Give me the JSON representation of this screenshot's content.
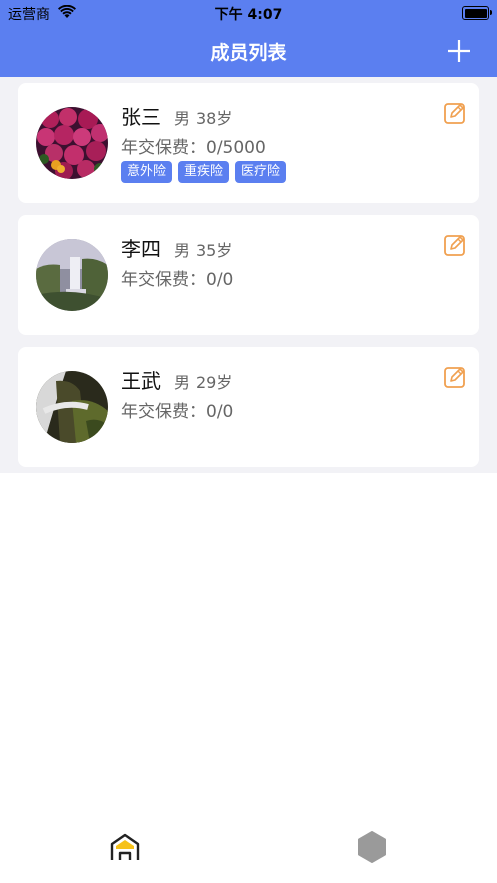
{
  "status": {
    "carrier": "运营商",
    "time": "下午 4:07"
  },
  "nav": {
    "title": "成员列表"
  },
  "members": [
    {
      "name": "张三",
      "gender": "男",
      "age": "38岁",
      "premium_label": "年交保费：",
      "premium_value": "0/5000",
      "tags": [
        "意外险",
        "重疾险",
        "医疗险"
      ],
      "avatar": "flowers"
    },
    {
      "name": "李四",
      "gender": "男",
      "age": "35岁",
      "premium_label": "年交保费：",
      "premium_value": "0/0",
      "tags": [],
      "avatar": "waterfall"
    },
    {
      "name": "王武",
      "gender": "男",
      "age": "29岁",
      "premium_label": "年交保费：",
      "premium_value": "0/0",
      "tags": [],
      "avatar": "stream"
    }
  ],
  "tabbar": {
    "home_icon": "home-icon",
    "other_icon": "hexagon-icon"
  },
  "colors": {
    "accent": "#5b7ff0",
    "edit": "#f0a050"
  }
}
